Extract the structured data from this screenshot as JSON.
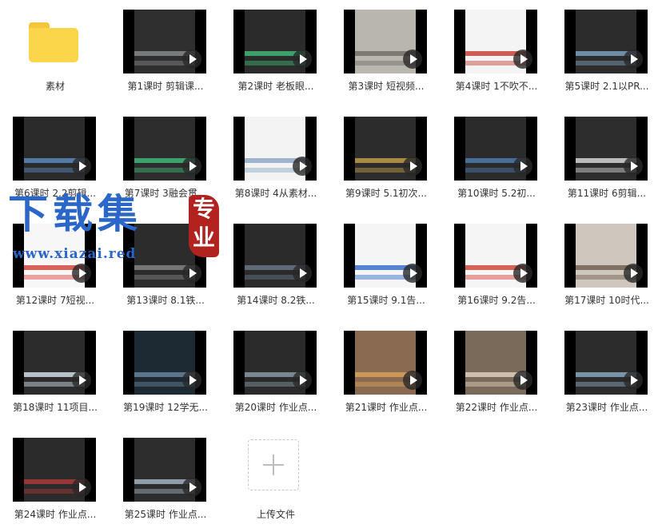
{
  "items": [
    {
      "type": "folder",
      "label": "素材"
    },
    {
      "type": "video",
      "label": "第1课时 剪辑课...",
      "bg": "#2f2f2f",
      "accent": "#8a8f8f"
    },
    {
      "type": "video",
      "label": "第2课时 老板眼...",
      "bg": "#2b2b2b",
      "accent": "#3fbf7a"
    },
    {
      "type": "video",
      "label": "第3课时 短视频...",
      "bg": "#b9b6b0",
      "accent": "#6f6a64"
    },
    {
      "type": "video",
      "label": "第4课时 1不吹不...",
      "bg": "#f4f4f4",
      "accent": "#c0392b"
    },
    {
      "type": "video",
      "label": "第5课时 2.1以PR...",
      "bg": "#2c2c2c",
      "accent": "#7fa8c6"
    },
    {
      "type": "video",
      "label": "第6课时 2.2剪辑...",
      "bg": "#2b2b2b",
      "accent": "#5b8fc7"
    },
    {
      "type": "video",
      "label": "第7课时 3融会贯...",
      "bg": "#2d2d2d",
      "accent": "#3fbf7a"
    },
    {
      "type": "video",
      "label": "第8课时 4从素材...",
      "bg": "#f3f3f3",
      "accent": "#8aa3c2"
    },
    {
      "type": "video",
      "label": "第9课时 5.1初次...",
      "bg": "#2c2c2c",
      "accent": "#c9a24a"
    },
    {
      "type": "video",
      "label": "第10课时 5.2初...",
      "bg": "#2b2b2b",
      "accent": "#4f7fb3"
    },
    {
      "type": "video",
      "label": "第11课时 6剪辑...",
      "bg": "#2d2d2d",
      "accent": "#e0e0e0"
    },
    {
      "type": "video",
      "label": "第12课时 7短视...",
      "bg": "#f7f7f7",
      "accent": "#d13c2f"
    },
    {
      "type": "video",
      "label": "第13课时 8.1铁...",
      "bg": "#2c2c2c",
      "accent": "#8a8a8a"
    },
    {
      "type": "video",
      "label": "第14课时 8.2铁...",
      "bg": "#2b2b2b",
      "accent": "#6b7b8b"
    },
    {
      "type": "video",
      "label": "第15课时 9.1告...",
      "bg": "#f5f5f5",
      "accent": "#2a67c9"
    },
    {
      "type": "video",
      "label": "第16课时 9.2告...",
      "bg": "#f5f5f5",
      "accent": "#d13c2f"
    },
    {
      "type": "video",
      "label": "第17课时 10时代...",
      "bg": "#cfc7be",
      "accent": "#6b5a4a"
    },
    {
      "type": "video",
      "label": "第18课时 11项目...",
      "bg": "#2c2c2c",
      "accent": "#dfe7f1"
    },
    {
      "type": "video",
      "label": "第19课时 12学无...",
      "bg": "#1d2a33",
      "accent": "#6a8aa0"
    },
    {
      "type": "video",
      "label": "第20课时 作业点...",
      "bg": "#2b2b2b",
      "accent": "#8f9fa8"
    },
    {
      "type": "video",
      "label": "第21课时 作业点...",
      "bg": "#8a6a50",
      "accent": "#d9a45a"
    },
    {
      "type": "video",
      "label": "第22课时 作业点...",
      "bg": "#7a6a5a",
      "accent": "#e3d6c2"
    },
    {
      "type": "video",
      "label": "第23课时 作业点...",
      "bg": "#2c2c2c",
      "accent": "#8fb0c8"
    },
    {
      "type": "video",
      "label": "第24课时 作业点...",
      "bg": "#2b2b2b",
      "accent": "#b33a3a"
    },
    {
      "type": "video",
      "label": "第25课时 作业点...",
      "bg": "#2d2d2d",
      "accent": "#a8b8c8"
    },
    {
      "type": "upload",
      "label": "上传文件"
    }
  ],
  "watermark": {
    "text": "下载集",
    "seal": "专业",
    "url": "www.xiazai.red"
  }
}
